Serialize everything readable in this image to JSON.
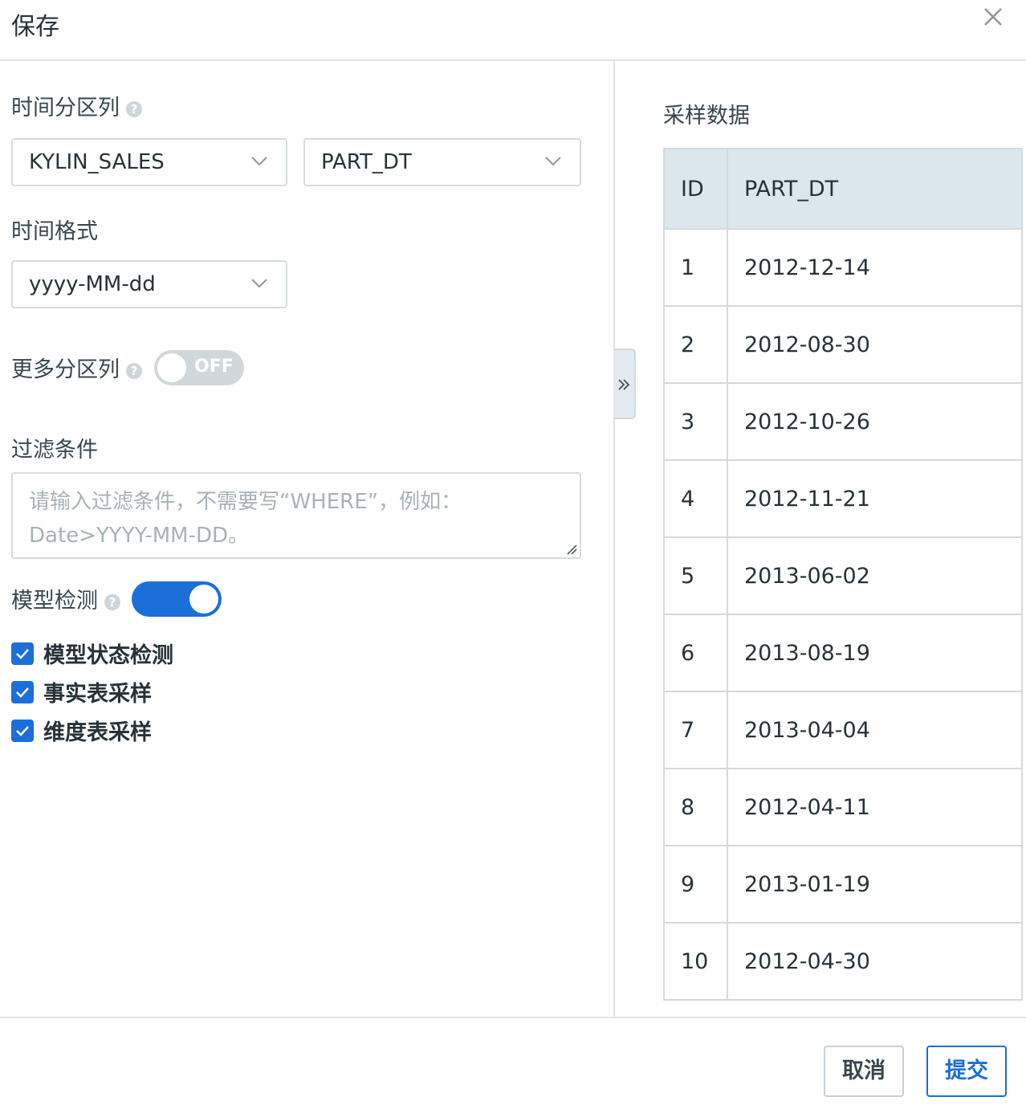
{
  "dialog": {
    "title": "保存"
  },
  "form": {
    "partition_label": "时间分区列",
    "table_select": "KYLIN_SALES",
    "column_select": "PART_DT",
    "format_label": "时间格式",
    "format_select": "yyyy-MM-dd",
    "more_partition_label": "更多分区列",
    "more_partition_toggle": "OFF",
    "filter_label": "过滤条件",
    "filter_placeholder_line1": "请输入过滤条件，不需要写“WHERE”，例如：",
    "filter_placeholder_line2": "Date>YYYY-MM-DD。",
    "model_check_label": "模型检测",
    "model_check_enabled": true,
    "checks": [
      {
        "label": "模型状态检测",
        "checked": true
      },
      {
        "label": "事实表采样",
        "checked": true
      },
      {
        "label": "维度表采样",
        "checked": true
      }
    ]
  },
  "sample": {
    "title": "采样数据",
    "columns": [
      "ID",
      "PART_DT"
    ],
    "rows": [
      [
        "1",
        "2012-12-14"
      ],
      [
        "2",
        "2012-08-30"
      ],
      [
        "3",
        "2012-10-26"
      ],
      [
        "4",
        "2012-11-21"
      ],
      [
        "5",
        "2013-06-02"
      ],
      [
        "6",
        "2013-08-19"
      ],
      [
        "7",
        "2013-04-04"
      ],
      [
        "8",
        "2012-04-11"
      ],
      [
        "9",
        "2013-01-19"
      ],
      [
        "10",
        "2012-04-30"
      ]
    ]
  },
  "footer": {
    "cancel": "取消",
    "submit": "提交"
  },
  "colors": {
    "accent": "#1b6fd8",
    "header_bg": "#dce6ed",
    "border": "#d5dbdf"
  }
}
